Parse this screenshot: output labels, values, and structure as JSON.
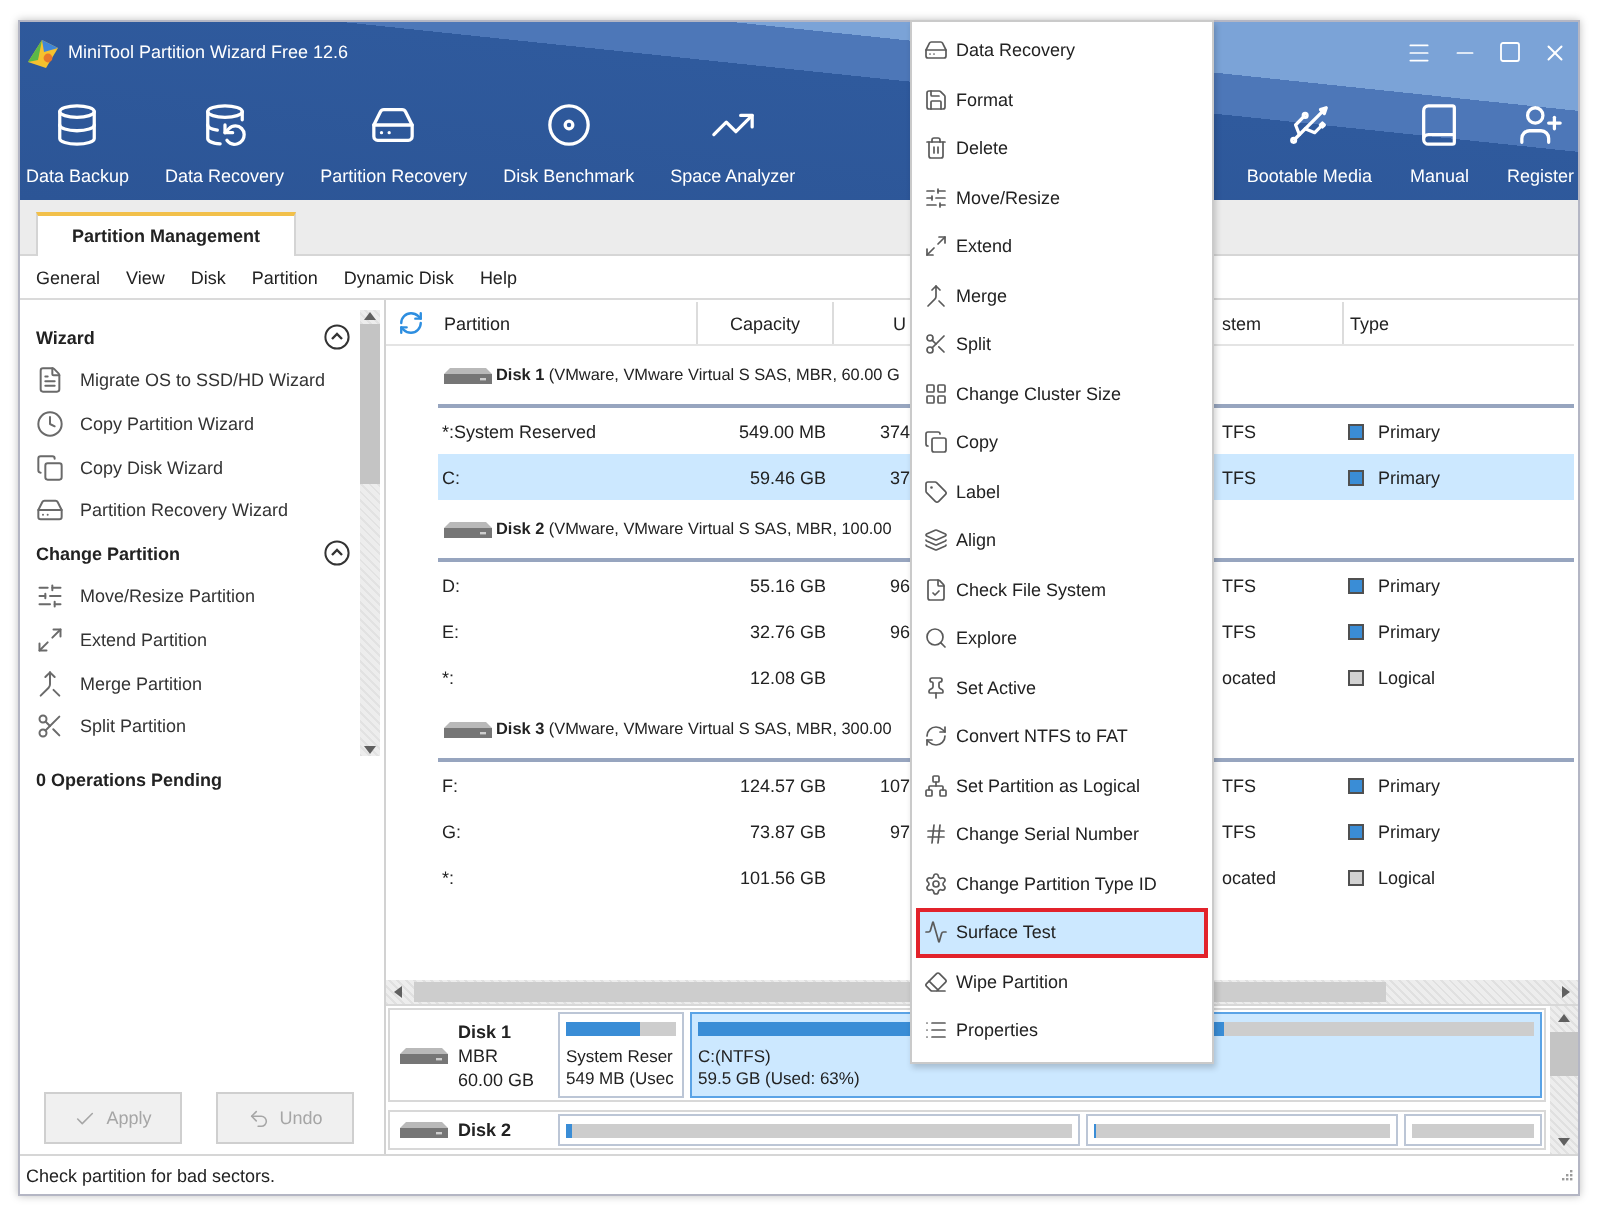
{
  "window": {
    "title": "MiniTool Partition Wizard Free 12.6"
  },
  "toolbar": {
    "left": [
      {
        "label": "Data Backup"
      },
      {
        "label": "Data Recovery"
      },
      {
        "label": "Partition Recovery"
      },
      {
        "label": "Disk Benchmark"
      },
      {
        "label": "Space Analyzer"
      }
    ],
    "right": [
      {
        "label": "Bootable Media"
      },
      {
        "label": "Manual"
      },
      {
        "label": "Register"
      }
    ]
  },
  "tabs": [
    {
      "label": "Partition Management",
      "selected": true
    }
  ],
  "menu_bar": [
    "General",
    "View",
    "Disk",
    "Partition",
    "Dynamic Disk",
    "Help"
  ],
  "sidebar": {
    "sections": [
      {
        "title": "Wizard",
        "expanded": true,
        "items": [
          "Migrate OS to SSD/HD Wizard",
          "Copy Partition Wizard",
          "Copy Disk Wizard",
          "Partition Recovery Wizard"
        ]
      },
      {
        "title": "Change Partition",
        "expanded": true,
        "items": [
          "Move/Resize Partition",
          "Extend Partition",
          "Merge Partition",
          "Split Partition"
        ]
      }
    ],
    "pending": "0 Operations Pending",
    "buttons": [
      {
        "label": "Apply",
        "disabled": true
      },
      {
        "label": "Undo",
        "disabled": true
      }
    ]
  },
  "table": {
    "columns": [
      "Partition",
      "Capacity",
      "U",
      "stem",
      "Type"
    ],
    "disks": [
      {
        "title": "**Disk 1** (VMware, VMware Virtual S SAS, MBR, 60.00 G",
        "partitions": [
          {
            "partition": "*:System Reserved",
            "capacity": "549.00 MB",
            "column_3": "374",
            "column_4": "TFS",
            "type": "Primary",
            "color": "#3a8dd6",
            "selected": false
          },
          {
            "partition": "C:",
            "capacity": "59.46 GB",
            "column_3": "37",
            "column_4": "TFS",
            "type": "Primary",
            "color": "#3a8dd6",
            "selected": true
          }
        ]
      },
      {
        "title": "**Disk 2** (VMware, VMware Virtual S SAS, MBR, 100.00",
        "partitions": [
          {
            "partition": "D:",
            "capacity": "55.16 GB",
            "column_3": "96",
            "column_4": "TFS",
            "type": "Primary",
            "color": "#3a8dd6",
            "selected": false
          },
          {
            "partition": "E:",
            "capacity": "32.76 GB",
            "column_3": "96",
            "column_4": "TFS",
            "type": "Primary",
            "color": "#3a8dd6",
            "selected": false
          },
          {
            "partition": "*:",
            "capacity": "12.08 GB",
            "column_4": "ocated",
            "type": "Logical",
            "color": "#d2d2d2",
            "selected": false
          }
        ]
      },
      {
        "title": "**Disk 3** (VMware, VMware Virtual S SAS, MBR, 300.00",
        "partitions": [
          {
            "partition": "F:",
            "capacity": "124.57 GB",
            "column_3": "107",
            "column_4": "TFS",
            "type": "Primary",
            "color": "#3a8dd6",
            "selected": false
          },
          {
            "partition": "G:",
            "capacity": "73.87 GB",
            "column_3": "97",
            "column_4": "TFS",
            "type": "Primary",
            "color": "#3a8dd6",
            "selected": false
          },
          {
            "partition": "*:",
            "capacity": "101.56 GB",
            "column_4": "ocated",
            "type": "Logical",
            "color": "#d2d2d2",
            "selected": false
          }
        ]
      }
    ]
  },
  "context_menu": [
    {
      "label": "Data Recovery",
      "selected": false
    },
    {
      "label": "Format",
      "selected": false
    },
    {
      "label": "Delete",
      "selected": false
    },
    {
      "label": "Move/Resize",
      "selected": false
    },
    {
      "label": "Extend",
      "selected": false
    },
    {
      "label": "Merge",
      "selected": false
    },
    {
      "label": "Split",
      "selected": false
    },
    {
      "label": "Change Cluster Size",
      "selected": false
    },
    {
      "label": "Copy",
      "selected": false
    },
    {
      "label": "Label",
      "selected": false
    },
    {
      "label": "Align",
      "selected": false
    },
    {
      "label": "Check File System",
      "selected": false
    },
    {
      "label": "Explore",
      "selected": false
    },
    {
      "label": "Set Active",
      "selected": false
    },
    {
      "label": "Convert NTFS to FAT",
      "selected": false
    },
    {
      "label": "Set Partition as Logical",
      "selected": false
    },
    {
      "label": "Change Serial Number",
      "selected": false
    },
    {
      "label": "Change Partition Type ID",
      "selected": false
    },
    {
      "label": "Surface Test",
      "selected": true
    },
    {
      "label": "Wipe Partition",
      "selected": false
    },
    {
      "label": "Properties",
      "selected": false
    }
  ],
  "disk_map": [
    {
      "name": "Disk 1",
      "lines": [
        "MBR",
        "60.00 GB"
      ],
      "partitions": [
        {
          "lines": [
            "System Reser",
            "549 MB (Usec"
          ],
          "level": 0.68,
          "selected": false
        },
        {
          "lines": [
            "C:(NTFS)",
            "59.5 GB (Used: 63%)"
          ],
          "level": 0.63,
          "selected": true
        }
      ]
    },
    {
      "name": "Disk 2",
      "partitions": [
        {
          "level": 0.01,
          "selected": false
        },
        {
          "level": 0.01,
          "selected": false
        },
        {
          "selected": false
        }
      ]
    }
  ],
  "status_bar": "Check partition for bad sectors."
}
